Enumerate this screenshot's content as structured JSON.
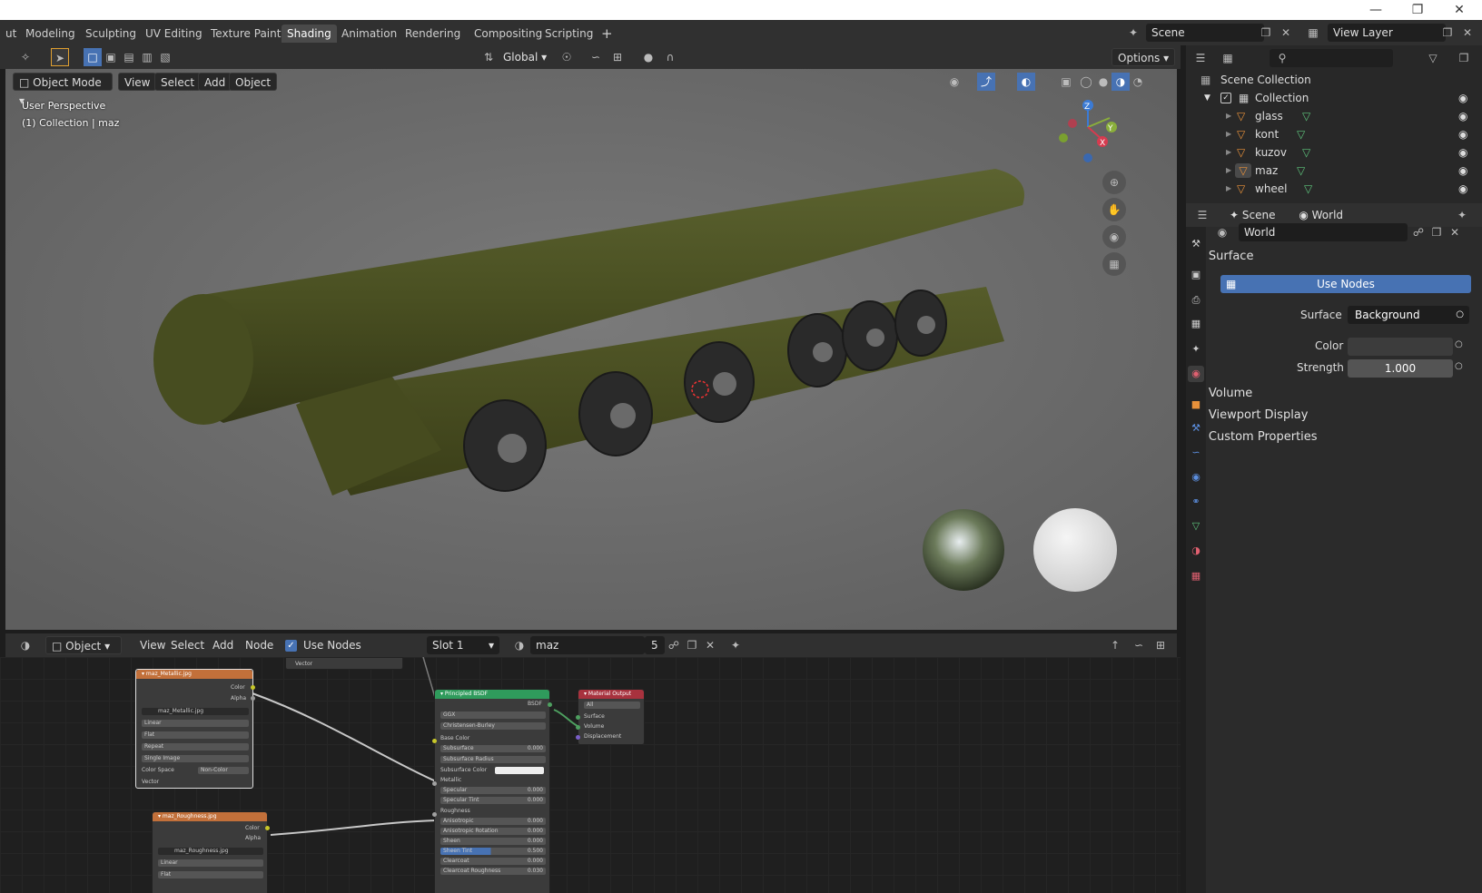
{
  "workspace_tabs": [
    {
      "label": "ut"
    },
    {
      "label": "Modeling"
    },
    {
      "label": "Sculpting"
    },
    {
      "label": "UV Editing"
    },
    {
      "label": "Texture Paint"
    },
    {
      "label": "Shading",
      "active": true
    },
    {
      "label": "Animation"
    },
    {
      "label": "Rendering"
    },
    {
      "label": "Compositing"
    },
    {
      "label": "Scripting"
    }
  ],
  "add_workspace": "+",
  "scene_name": "Scene",
  "view_layer": "View Layer",
  "viewport": {
    "transform_orientation": "Global",
    "options_label": "Options",
    "mode": "Object Mode",
    "menus": [
      "View",
      "Select",
      "Add",
      "Object"
    ],
    "overlay_title": "User Perspective",
    "overlay_sub": "(1) Collection | maz",
    "gizmo_axes": {
      "z": "Z",
      "y": "Y",
      "x": "X"
    }
  },
  "node_editor": {
    "type": "Object",
    "menus": [
      "View",
      "Select",
      "Add",
      "Node"
    ],
    "use_nodes_label": "Use Nodes",
    "use_nodes_checked": true,
    "slot": "Slot 1",
    "material": "maz",
    "users": "5",
    "nodes": {
      "metallic": {
        "title": "maz_Metallic.jpg",
        "outputs": [
          "Color",
          "Alpha"
        ],
        "image": "maz_Metallic.jpg",
        "fields": [
          "Linear",
          "Flat",
          "Repeat",
          "Single Image"
        ],
        "color_space_label": "Color Space",
        "color_space": "Non-Color",
        "vector": "Vector"
      },
      "roughness": {
        "title": "maz_Roughness.jpg",
        "outputs": [
          "Color",
          "Alpha"
        ],
        "image": "maz_Roughness.jpg",
        "fields": [
          "Linear",
          "Flat"
        ]
      },
      "top_vector": "Vector",
      "bsdf": {
        "title": "Principled BSDF",
        "output": "BSDF",
        "dist": "GGX",
        "sss": "Christensen-Burley",
        "base_color": "Base Color",
        "subsurface": "Subsurface",
        "subsurface_val": "0.000",
        "subsurface_radius": "Subsurface Radius",
        "subsurface_color": "Subsurface Color",
        "metallic": "Metallic",
        "specular": "Specular",
        "specular_val": "0.000",
        "specular_tint": "Specular Tint",
        "specular_tint_val": "0.000",
        "roughness": "Roughness",
        "anisotropic": "Anisotropic",
        "anisotropic_val": "0.000",
        "anisotropic_rotation": "Anisotropic Rotation",
        "anisotropic_rotation_val": "0.000",
        "sheen": "Sheen",
        "sheen_val": "0.000",
        "sheen_tint": "Sheen Tint",
        "sheen_tint_val": "0.500",
        "clearcoat": "Clearcoat",
        "clearcoat_val": "0.000",
        "clearcoat_roughness": "Clearcoat Roughness",
        "clearcoat_roughness_val": "0.030"
      },
      "output": {
        "title": "Material Output",
        "target": "All",
        "inputs": [
          "Surface",
          "Volume",
          "Displacement"
        ]
      }
    }
  },
  "outliner": {
    "root": "Scene Collection",
    "collection": "Collection",
    "objects": [
      "glass",
      "kont",
      "kuzov",
      "maz",
      "wheel"
    ]
  },
  "properties": {
    "breadcrumb_scene": "Scene",
    "breadcrumb_world": "World",
    "world_name": "World",
    "surface_panel": "Surface",
    "use_nodes_button": "Use Nodes",
    "surface_label": "Surface",
    "surface_value": "Background",
    "color_label": "Color",
    "strength_label": "Strength",
    "strength_value": "1.000",
    "panels": [
      "Volume",
      "Viewport Display",
      "Custom Properties"
    ]
  },
  "colors": {
    "accent": "#4772b3",
    "vehicle": "#4d5222",
    "header_orange": "#c2703a",
    "header_green": "#2f9b5c",
    "header_red": "#a8323e"
  }
}
